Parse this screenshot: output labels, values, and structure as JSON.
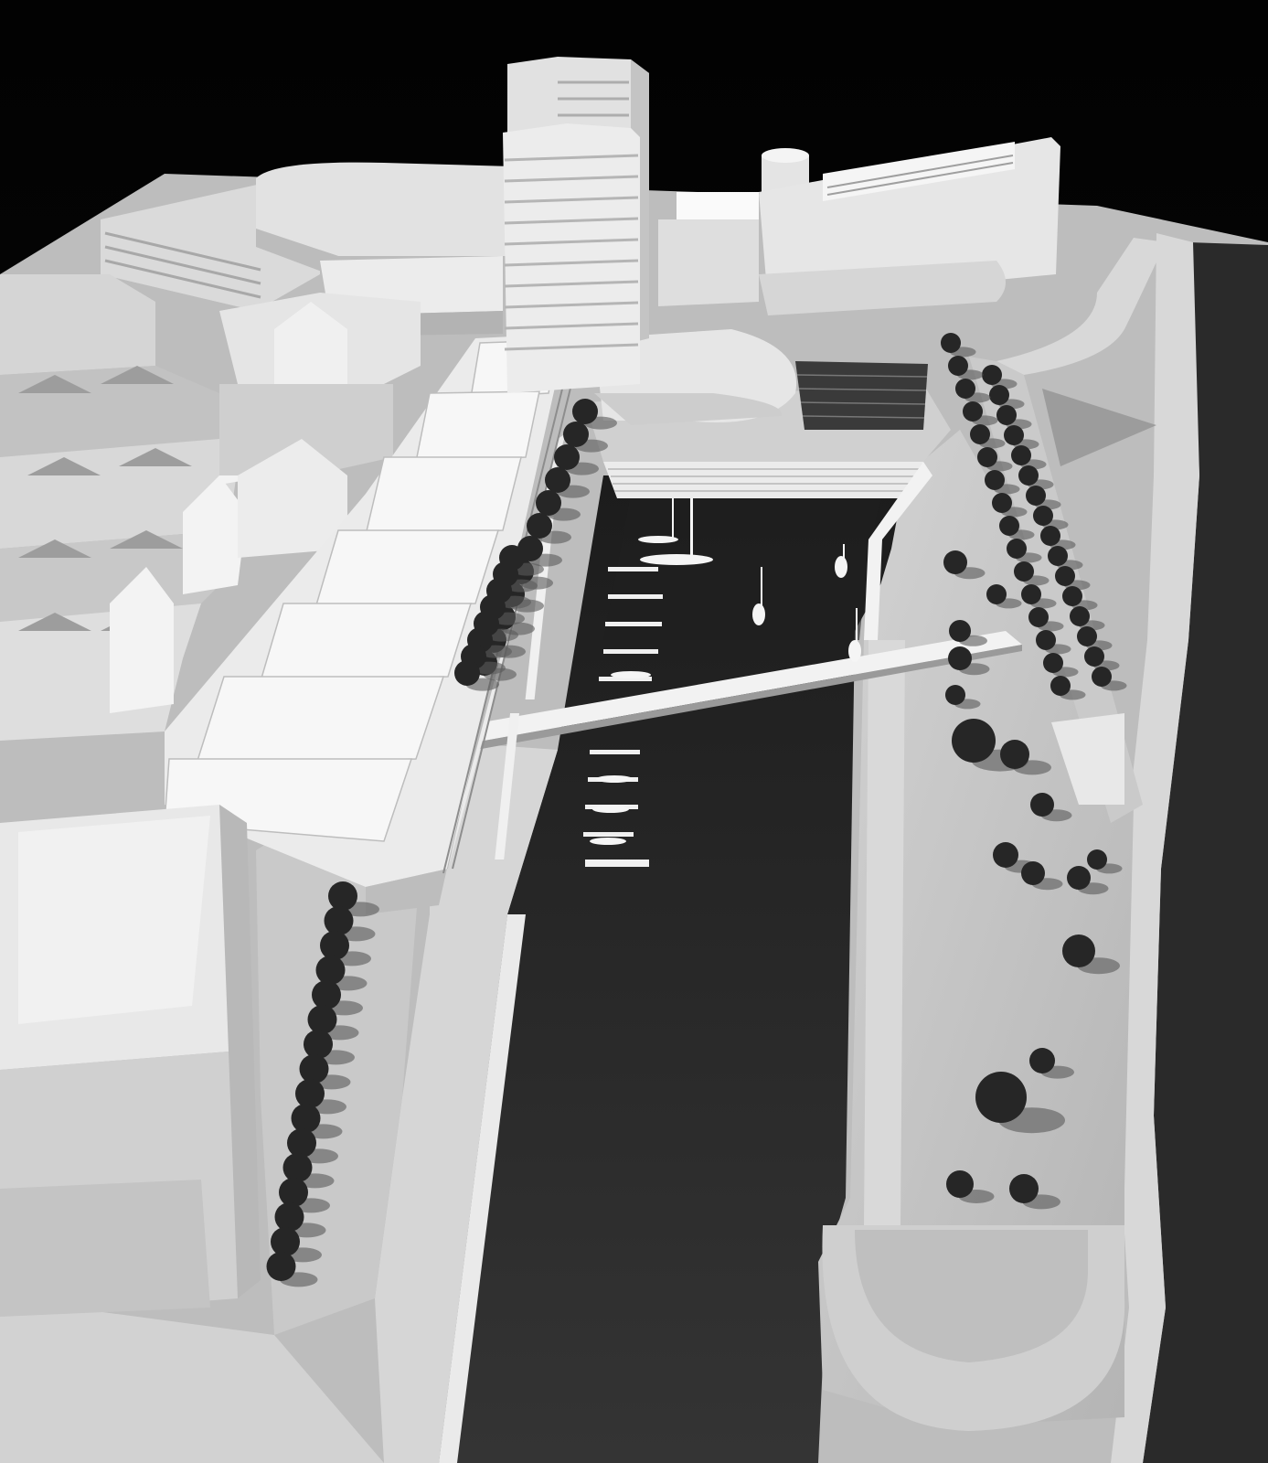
{
  "image": {
    "kind": "photo",
    "subject": "architectural-site-model",
    "palette": {
      "background": "#050505",
      "model_white": "#e4e4e4",
      "model_light": "#efefef",
      "model_mid": "#c6c6c6",
      "model_shadow": "#9a9a9a",
      "water": "#2e2e2e",
      "water_dark": "#232323",
      "tree": "#262626",
      "tree_shadow": "#5a5a5a"
    }
  }
}
